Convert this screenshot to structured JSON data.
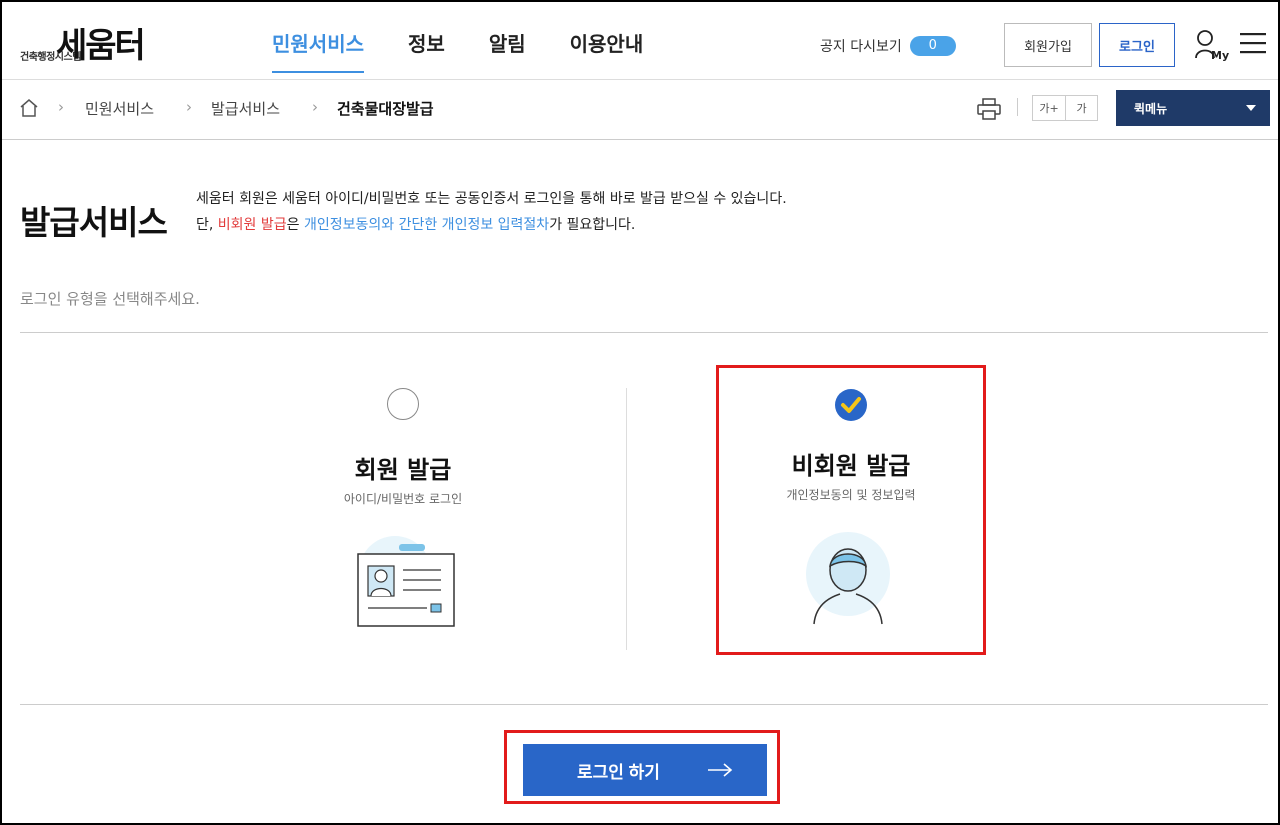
{
  "logo": {
    "main": "세움터",
    "sub": "건축행정시스템"
  },
  "gnb": [
    "민원서비스",
    "정보",
    "알림",
    "이용안내"
  ],
  "notice": {
    "label": "공지 다시보기",
    "count": "0"
  },
  "header_buttons": {
    "join": "회원가입",
    "login": "로그인",
    "my": "My"
  },
  "breadcrumb": {
    "items": [
      "민원서비스",
      "발급서비스"
    ],
    "current": "건축물대장발급"
  },
  "font_controls": {
    "increase": "가+",
    "decrease": "가"
  },
  "quickmenu": "퀵메뉴",
  "page": {
    "title": "발급서비스",
    "desc_line1": "세움터 회원은 세움터 아이디/비밀번호 또는 공동인증서 로그인을 통해 바로 발급 받으실 수 있습니다.",
    "desc_line2_prefix": "단, ",
    "desc_line2_red": "비회원 발급",
    "desc_line2_mid": "은 ",
    "desc_line2_blue": "개인정보동의와 간단한 개인정보 입력절차",
    "desc_line2_suffix": "가 필요합니다.",
    "hint": "로그인 유형을 선택해주세요."
  },
  "options": {
    "member": {
      "title": "회원 발급",
      "sub": "아이디/비밀번호 로그인",
      "selected": false
    },
    "guest": {
      "title": "비회원 발급",
      "sub": "개인정보동의 및 정보입력",
      "selected": true
    }
  },
  "login_button": "로그인 하기",
  "colors": {
    "accent_blue": "#2966c8",
    "gnb_active": "#3d8fe0",
    "highlight_red": "#e21b1b",
    "check_yellow": "#f5c518"
  }
}
